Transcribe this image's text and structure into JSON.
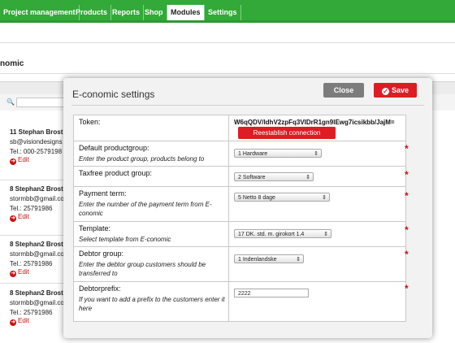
{
  "nav": {
    "tabs": [
      {
        "label": "Project management"
      },
      {
        "label": "Products"
      },
      {
        "label": "Reports"
      },
      {
        "label": "Shop"
      },
      {
        "label": "Modules"
      },
      {
        "label": "Settings"
      }
    ],
    "active": "Modules"
  },
  "page": {
    "heading": "nomic"
  },
  "customers": [
    {
      "name": "11 Stephan Brost",
      "email": "sb@visiondesigns",
      "tel": "Tel.: 000-2579198",
      "edit": "Edit"
    },
    {
      "name": "8 Stephan2 Brost",
      "email": "stormbb@gmail.co",
      "tel": "Tel.: 25791986",
      "edit": "Edit"
    },
    {
      "name": "8 Stephan2 Brost",
      "email": "stormbb@gmail.co",
      "tel": "Tel.: 25791986",
      "edit": "Edit"
    },
    {
      "name": "8 Stephan2 Brost",
      "email": "stormbb@gmail.co",
      "tel": "Tel.: 25791986",
      "edit": "Edit"
    }
  ],
  "modal": {
    "title": "E-conomic settings",
    "close_label": "Close",
    "save_label": "Save",
    "token": {
      "label": "Token:",
      "value": "W6qQDV/ldhV2zpFq3VIDrR1gn9lEwg7icsikbb/JajM=",
      "reestablish_label": "Reestablish connection"
    },
    "fields": {
      "productgroup": {
        "label": "Default productgroup:",
        "hint": "Enter the product group, products belong to",
        "value": "1 Hardware"
      },
      "taxfree": {
        "label": "Taxfree product group:",
        "hint": "",
        "value": "2 Software"
      },
      "payment": {
        "label": "Payment term:",
        "hint": "Enter the number of the payment term from E-conomic",
        "value": "5 Netto 8 dage"
      },
      "template": {
        "label": "Template:",
        "hint": "Select template from E-conomic",
        "value": "17 DK. std. m. girokort 1.4"
      },
      "debtor": {
        "label": "Debtor group:",
        "hint": "Enter the debtor group customers should be transferred to",
        "value": "1 Indenlandske"
      },
      "prefix": {
        "label": "Debtorprefix:",
        "hint": "If you want to add a prefix to the customers enter it here",
        "value": "2222"
      }
    },
    "required_mark": "*"
  },
  "colors": {
    "nav_green": "#32a938",
    "save_red": "#dd1c24",
    "close_gray": "#7c7c7c"
  }
}
